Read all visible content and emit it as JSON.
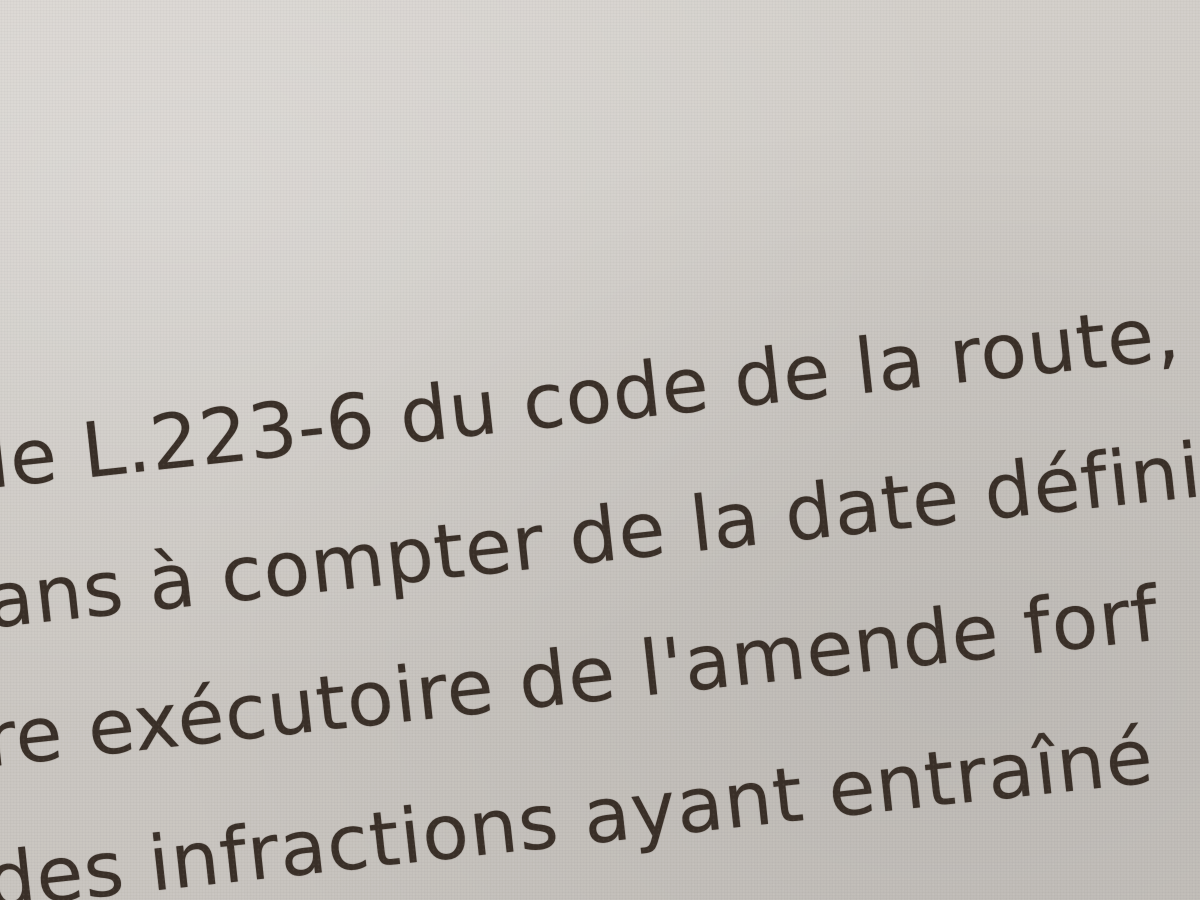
{
  "document": {
    "lines": [
      "le L.223-6 du code de la route,",
      "ans à compter de la date défini",
      "re exécutoire de l'amende forf",
      "des infractions ayant entraîné",
      ""
    ]
  }
}
